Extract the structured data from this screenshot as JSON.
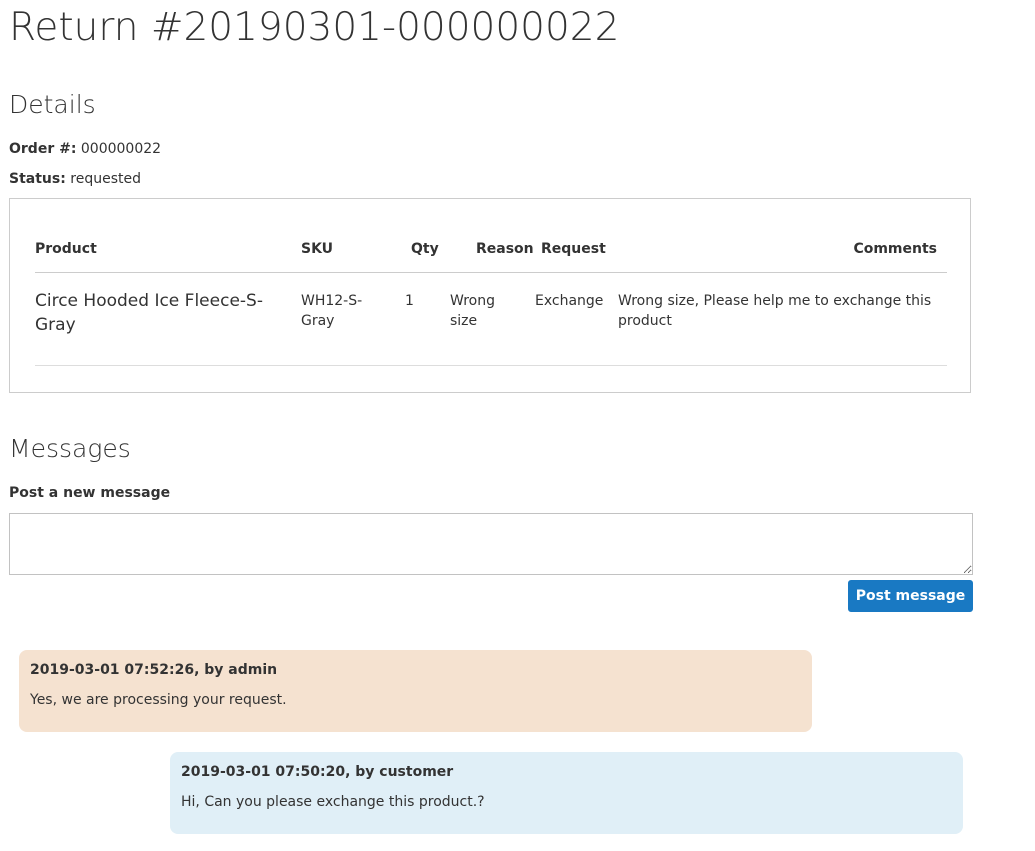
{
  "page": {
    "title": "Return #20190301-000000022"
  },
  "details": {
    "heading": "Details",
    "order_label": "Order #:",
    "order_value": "000000022",
    "status_label": "Status:",
    "status_value": "requested"
  },
  "items_table": {
    "headers": {
      "product": "Product",
      "sku": "SKU",
      "qty": "Qty",
      "reason": "Reason",
      "request": "Request",
      "comments": "Comments"
    },
    "rows": [
      {
        "product": "Circe Hooded Ice Fleece-S-Gray",
        "sku": "WH12-S-Gray",
        "qty": "1",
        "reason": "Wrong size",
        "request": "Exchange",
        "comments": "Wrong size, Please help me to exchange this product"
      }
    ]
  },
  "messages": {
    "heading": "Messages",
    "post_label": "Post a new message",
    "input_value": "",
    "post_button_label": "Post message",
    "list": [
      {
        "header": "2019-03-01 07:52:26, by admin",
        "body": "Yes, we are processing your request.",
        "author": "admin",
        "color": "#f5e2d0"
      },
      {
        "header": "2019-03-01 07:50:20, by customer",
        "body": "Hi, Can you please exchange this product.?",
        "author": "customer",
        "color": "#e0eff7"
      }
    ]
  },
  "colors": {
    "accent": "#1979c3",
    "text": "#333333",
    "border": "#cccccc"
  }
}
